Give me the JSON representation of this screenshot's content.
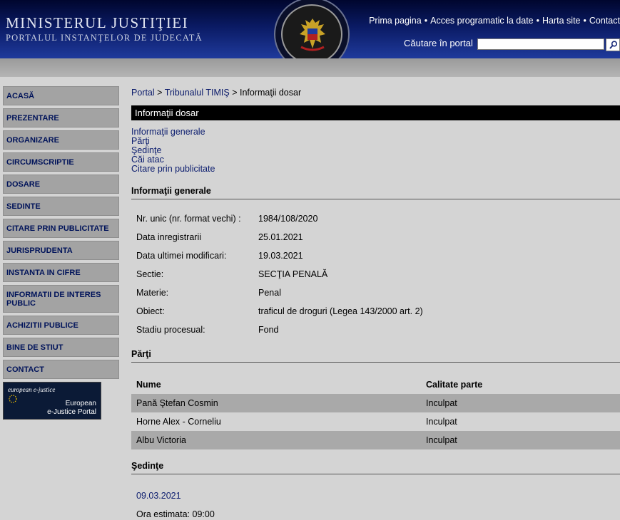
{
  "header": {
    "title": "MINISTERUL JUSTIŢIEI",
    "subtitle": "PORTALUL INSTANŢELOR DE JUDECATĂ",
    "nav": [
      "Prima pagina",
      "Acces programatic la date",
      "Harta site",
      "Contact"
    ],
    "search_label": "Căutare în portal",
    "search_value": ""
  },
  "sidebar": {
    "items": [
      {
        "label": "ACASĂ"
      },
      {
        "label": "PREZENTARE"
      },
      {
        "label": "ORGANIZARE"
      },
      {
        "label": "CIRCUMSCRIPTIE"
      },
      {
        "label": "DOSARE"
      },
      {
        "label": "SEDINTE"
      },
      {
        "label": "CITARE PRIN PUBLICITATE"
      },
      {
        "label": "JURISPRUDENTA"
      },
      {
        "label": "INSTANTA IN CIFRE"
      },
      {
        "label": "INFORMATII DE INTERES PUBLIC"
      },
      {
        "label": "ACHIZITII PUBLICE"
      },
      {
        "label": "BINE DE STIUT"
      },
      {
        "label": "CONTACT"
      }
    ],
    "banner": {
      "tag": "european e-justice",
      "line1": "European",
      "line2": "e-Justice Portal"
    }
  },
  "breadcrumb": {
    "items": [
      "Portal",
      "Tribunalul TIMIŞ",
      "Informaţii dosar"
    ]
  },
  "page_title": "Informaţii dosar",
  "anchors": [
    "Informaţii generale",
    "Părţi",
    "Şedinţe",
    "Căi atac",
    "Citare prin publicitate"
  ],
  "general": {
    "heading": "Informaţii generale",
    "rows": [
      {
        "key": "Nr. unic (nr. format vechi) :",
        "value": "1984/108/2020"
      },
      {
        "key": "Data inregistrarii",
        "value": "25.01.2021"
      },
      {
        "key": "Data ultimei modificari:",
        "value": "19.03.2021"
      },
      {
        "key": "Sectie:",
        "value": "SECŢIA PENALĂ"
      },
      {
        "key": "Materie:",
        "value": "Penal"
      },
      {
        "key": "Obiect:",
        "value": "traficul de droguri (Legea 143/2000 art. 2)"
      },
      {
        "key": "Stadiu procesual:",
        "value": "Fond"
      }
    ]
  },
  "parti": {
    "heading": "Părţi",
    "columns": [
      "Nume",
      "Calitate parte"
    ],
    "rows": [
      {
        "name": "Pană Ştefan Cosmin",
        "role": "Inculpat"
      },
      {
        "name": "Horne Alex - Corneliu",
        "role": "Inculpat"
      },
      {
        "name": "Albu Victoria",
        "role": "Inculpat"
      }
    ]
  },
  "sedinte": {
    "heading": "Şedinţe",
    "date": "09.03.2021",
    "ora": "Ora estimata: 09:00"
  }
}
